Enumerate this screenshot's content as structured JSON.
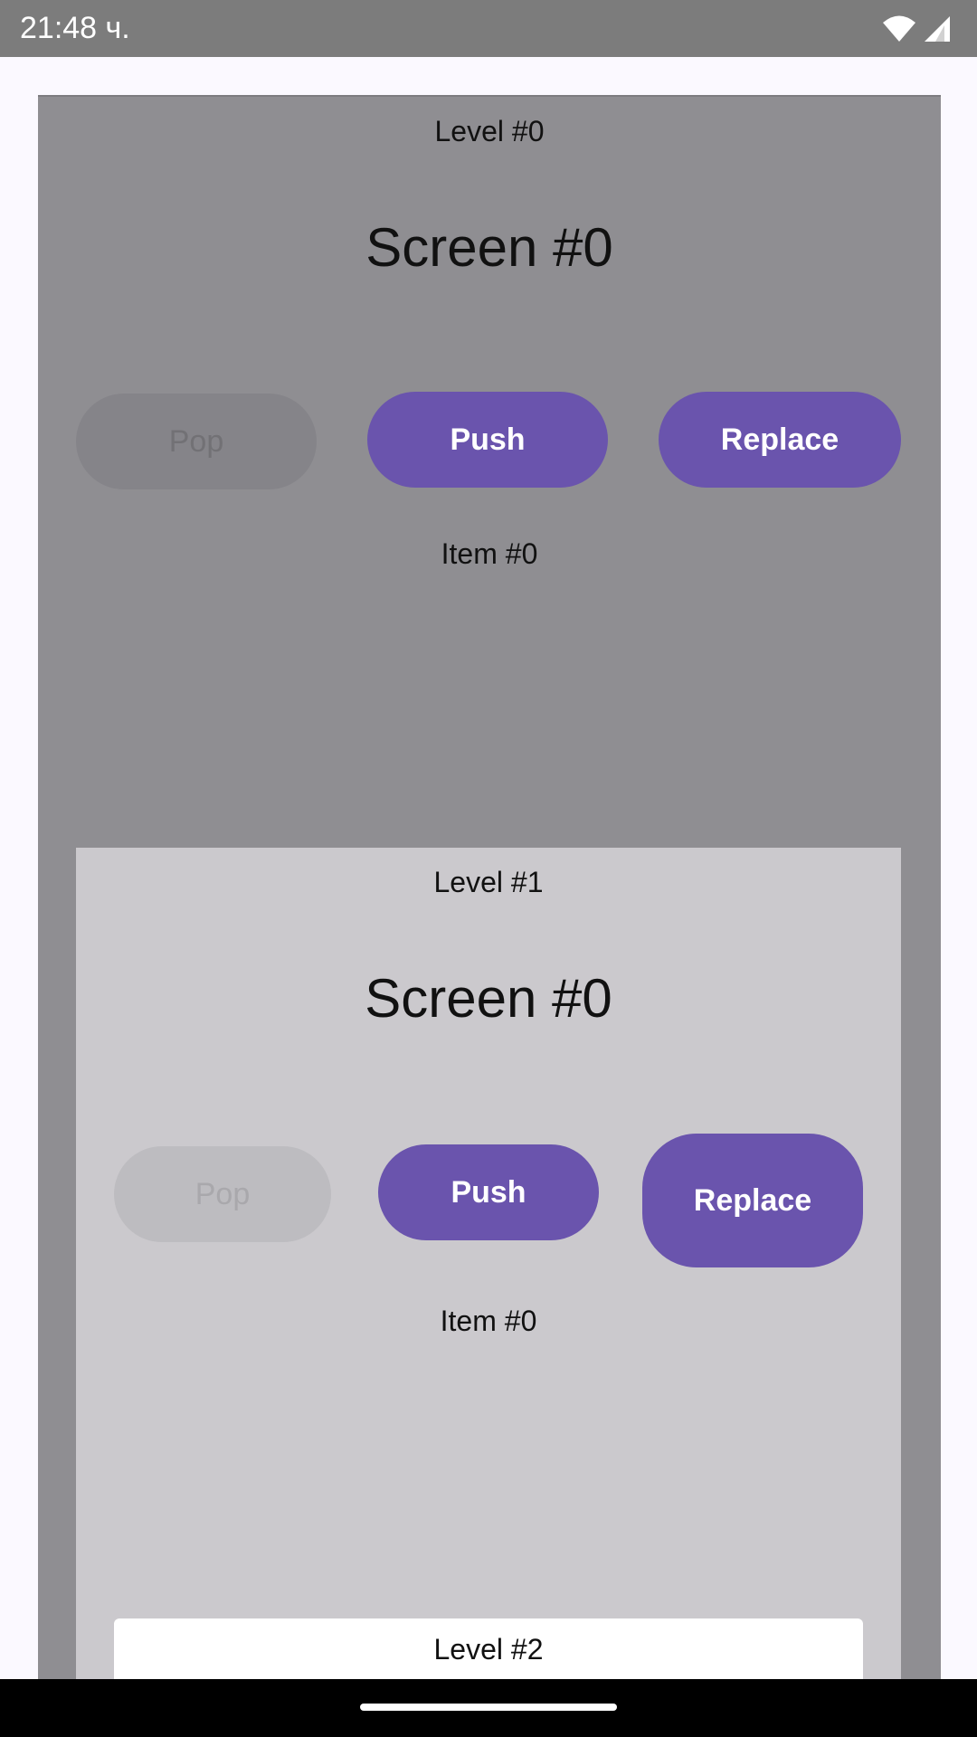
{
  "status_bar": {
    "time": "21:48 ч."
  },
  "levels": [
    {
      "level_label": "Level #0",
      "screen_title": "Screen #0",
      "buttons": {
        "pop": "Pop",
        "push": "Push",
        "replace": "Replace"
      },
      "item_label": "Item #0"
    },
    {
      "level_label": "Level #1",
      "screen_title": "Screen #0",
      "buttons": {
        "pop": "Pop",
        "push": "Push",
        "replace": "Replace"
      },
      "item_label": "Item #0"
    },
    {
      "level_label": "Level #2"
    }
  ],
  "colors": {
    "accent": "#6a54ad",
    "scrim_level_0": "#8f8e92",
    "scrim_level_1": "#cbc9cd",
    "surface": "#ffffff"
  },
  "icons": [
    "wifi-icon",
    "cellular-signal-icon"
  ]
}
